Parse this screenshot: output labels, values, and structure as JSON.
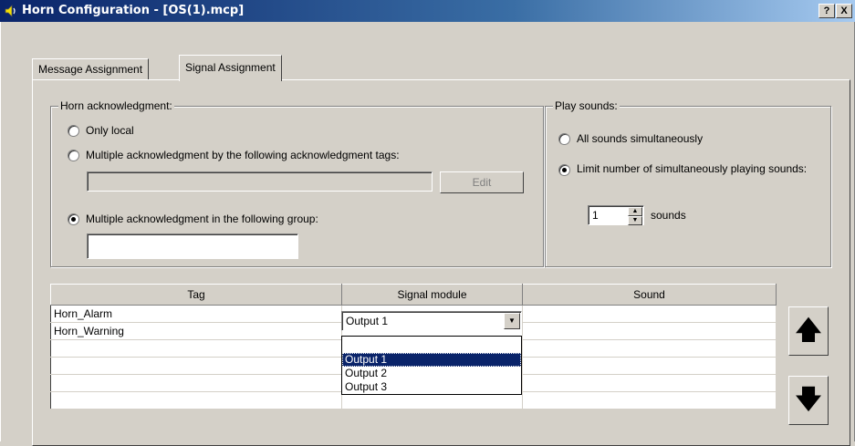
{
  "window": {
    "title": "Horn Configuration - [OS(1).mcp]",
    "help_label": "?",
    "close_label": "X"
  },
  "tabs": [
    {
      "label": "Message Assignment",
      "active": false
    },
    {
      "label": "Signal Assignment",
      "active": true
    }
  ],
  "horn_ack": {
    "legend": "Horn acknowledgment:",
    "options": [
      {
        "label": "Only local",
        "selected": false
      },
      {
        "label": "Multiple acknowledgment by the following acknowledgment tags:",
        "selected": false
      },
      {
        "label": "Multiple acknowledgment in the following group:",
        "selected": true
      }
    ],
    "tags_value": "",
    "edit_label": "Edit",
    "group_value": ""
  },
  "play_sounds": {
    "legend": "Play sounds:",
    "options": [
      {
        "label": "All sounds simultaneously",
        "selected": false
      },
      {
        "label": "Limit number of simultaneously playing sounds:",
        "selected": true
      }
    ],
    "limit_value": "1",
    "limit_unit": "sounds"
  },
  "grid": {
    "columns": [
      "Tag",
      "Signal module",
      "Sound"
    ],
    "rows": [
      {
        "tag": "Horn_Alarm",
        "signal_module": "Output 1",
        "sound": ""
      },
      {
        "tag": "Horn_Warning",
        "signal_module": "",
        "sound": ""
      },
      {
        "tag": "",
        "signal_module": "",
        "sound": ""
      },
      {
        "tag": "",
        "signal_module": "",
        "sound": ""
      },
      {
        "tag": "",
        "signal_module": "",
        "sound": ""
      },
      {
        "tag": "",
        "signal_module": "",
        "sound": ""
      }
    ]
  },
  "signal_dropdown": {
    "selected": "Output 1",
    "options": [
      "Output 1",
      "Output 2",
      "Output 3"
    ]
  },
  "nav": {
    "up_icon": "arrow-up-icon",
    "down_icon": "arrow-down-icon"
  }
}
